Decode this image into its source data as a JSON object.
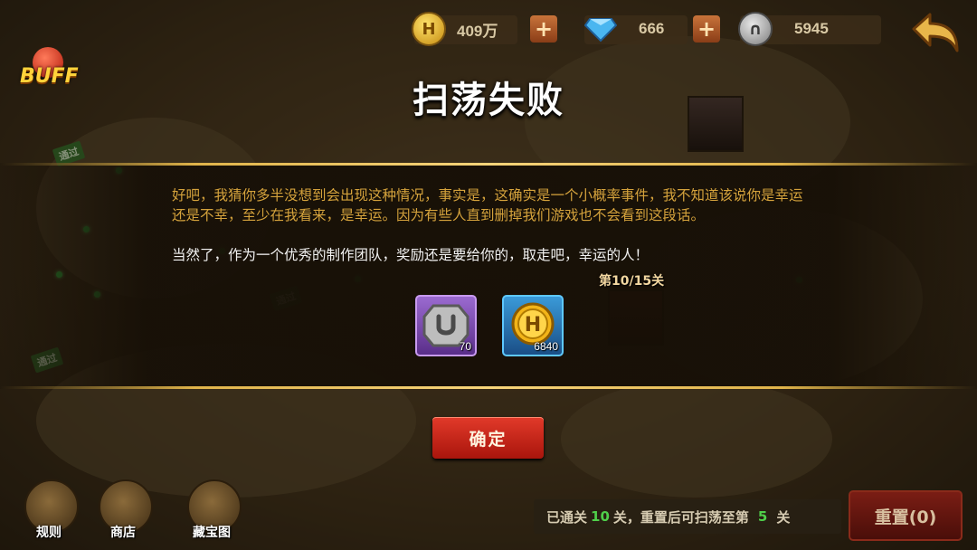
{
  "currency": {
    "gold": {
      "icon": "gold-coin-h-icon",
      "value": "409万"
    },
    "diamond": {
      "icon": "diamond-gem-icon",
      "value": "666"
    },
    "silver": {
      "icon": "silver-horseshoe-coin-icon",
      "value": "5945"
    }
  },
  "buff_label": "BUFF",
  "map": {
    "passed_sign": "通过",
    "stage_label": "第10/15关"
  },
  "dialog": {
    "title": "扫荡失败",
    "message": "好吧，我猜你多半没想到会出现这种情况，事实是，这确实是一个小概率事件，我不知道该说你是幸运还是不幸，至少在我看来，是幸运。因为有些人直到删掉我们游戏也不会看到这段话。",
    "message2": "当然了，作为一个优秀的制作团队，奖励还是要给你的，取走吧，幸运的人！",
    "rewards": [
      {
        "icon": "silver-horseshoe-coin-icon",
        "quantity": "70"
      },
      {
        "icon": "gold-coin-h-icon",
        "quantity": "6840"
      }
    ],
    "confirm_label": "确定"
  },
  "menu": [
    {
      "label": "规则",
      "icon": "rules-book-icon"
    },
    {
      "label": "商店",
      "icon": "shop-merchant-icon"
    },
    {
      "label": "藏宝图",
      "icon": "treasure-map-icon"
    }
  ],
  "status": {
    "prefix": "已通关",
    "cleared": "10",
    "middle": "关，重置后可扫荡至第",
    "target": "5",
    "suffix": "关"
  },
  "reset_label": "重置(0)",
  "colors": {
    "message_gold": "#d4a23c",
    "panel_border": "#e0b44a",
    "confirm_red": "#c92618",
    "status_green": "#4fcf4a"
  }
}
